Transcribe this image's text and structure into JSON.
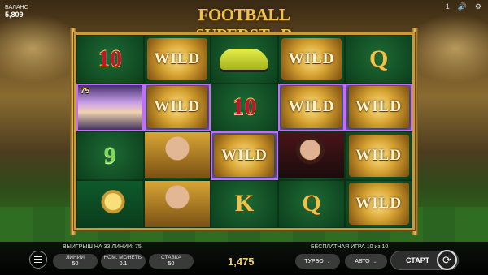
{
  "balance": {
    "label": "БАЛАНС",
    "value": "5,809"
  },
  "logo": {
    "text_a": "FOOTBALL SUPERST",
    "star": "★",
    "text_b": "R"
  },
  "top_icons": {
    "info": "1",
    "sound": "🔊",
    "settings": "⚙"
  },
  "reels": {
    "badge": "75",
    "cells": [
      [
        {
          "type": "ten",
          "text": "10",
          "win": false
        },
        {
          "type": "wild",
          "text": "WILD",
          "win": false
        },
        {
          "type": "car",
          "text": "",
          "win": false
        },
        {
          "type": "wild",
          "text": "WILD",
          "win": false
        },
        {
          "type": "letter",
          "text": "Q",
          "win": false
        }
      ],
      [
        {
          "type": "player-a",
          "text": "",
          "win": true
        },
        {
          "type": "wild",
          "text": "WILD",
          "win": true
        },
        {
          "type": "ten",
          "text": "10",
          "win": false
        },
        {
          "type": "wild",
          "text": "WILD",
          "win": true
        },
        {
          "type": "wild",
          "text": "WILD",
          "win": true
        }
      ],
      [
        {
          "type": "nine",
          "text": "9",
          "win": false
        },
        {
          "type": "player-b",
          "text": "",
          "win": false
        },
        {
          "type": "wild",
          "text": "WILD",
          "win": true
        },
        {
          "type": "player-c",
          "text": "",
          "win": false
        },
        {
          "type": "wild",
          "text": "WILD",
          "win": false
        }
      ],
      [
        {
          "type": "trophy",
          "text": "",
          "win": false
        },
        {
          "type": "player-b",
          "text": "",
          "win": false
        },
        {
          "type": "letter",
          "text": "K",
          "win": false
        },
        {
          "type": "letter",
          "text": "Q",
          "win": false
        },
        {
          "type": "wild",
          "text": "WILD",
          "win": false
        }
      ]
    ]
  },
  "status": {
    "win_text": "ВЫИГРЫШ НА 33 ЛИНИИ: 75",
    "free_game": "БЕСПЛАТНАЯ ИГРА 10 из 10"
  },
  "controls": {
    "lines_label": "ЛИНИИ",
    "lines_value": "50",
    "coin_label": "НОМ. МОНЕТЫ",
    "coin_value": "0.1",
    "bet_label": "СТАВКА",
    "bet_value": "50",
    "total": "1,475",
    "turbo": "ТУРБО",
    "auto": "АВТО",
    "start": "СТАРТ",
    "chevron": "⌄"
  }
}
